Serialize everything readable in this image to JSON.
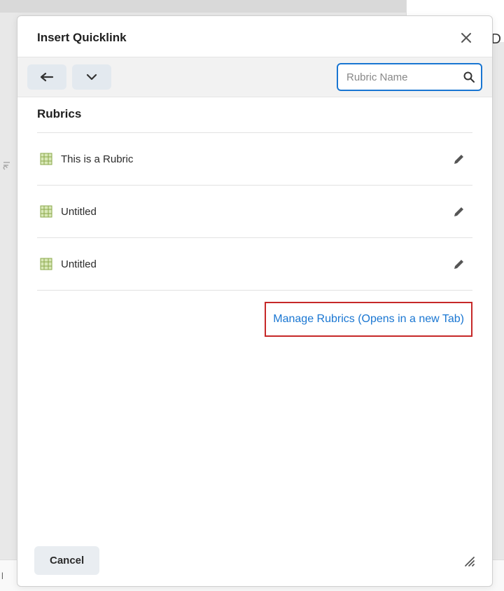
{
  "backdrop": {
    "letter": "D",
    "bottom_text": "l"
  },
  "modal": {
    "title": "Insert Quicklink",
    "search": {
      "placeholder": "Rubric Name"
    },
    "section_title": "Rubrics",
    "rubrics": [
      {
        "label": "This is a Rubric"
      },
      {
        "label": "Untitled"
      },
      {
        "label": "Untitled"
      }
    ],
    "manage_link": "Manage Rubrics (Opens in a new Tab)",
    "footer": {
      "cancel": "Cancel"
    }
  }
}
